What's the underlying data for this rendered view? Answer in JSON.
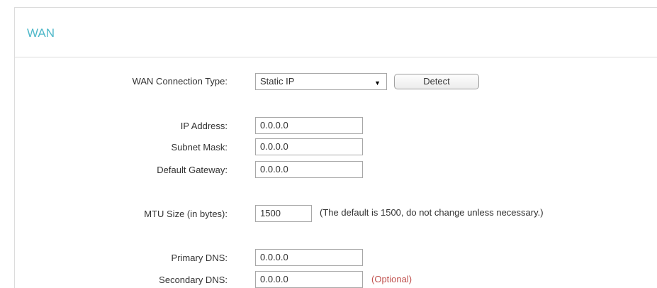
{
  "panel": {
    "title": "WAN",
    "title_color": "#4fb8c9"
  },
  "connection": {
    "label": "WAN Connection Type:",
    "selected": "Static IP",
    "detect_label": "Detect"
  },
  "ip": {
    "label": "IP Address:",
    "value": "0.0.0.0"
  },
  "subnet": {
    "label": "Subnet Mask:",
    "value": "0.0.0.0"
  },
  "gateway": {
    "label": "Default Gateway:",
    "value": "0.0.0.0"
  },
  "mtu": {
    "label": "MTU Size (in bytes):",
    "value": "1500",
    "note": "(The default is 1500, do not change unless necessary.)"
  },
  "primary_dns": {
    "label": "Primary DNS:",
    "value": "0.0.0.0"
  },
  "secondary_dns": {
    "label": "Secondary DNS:",
    "value": "0.0.0.0",
    "optional_note": "(Optional)",
    "optional_color": "#c0504d"
  }
}
